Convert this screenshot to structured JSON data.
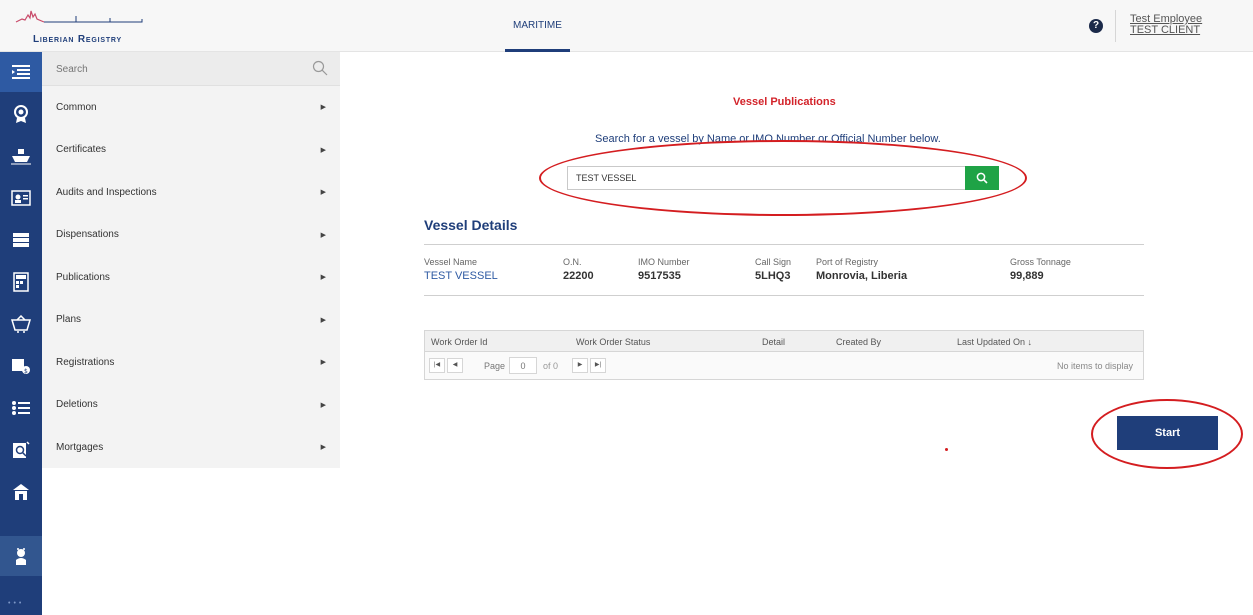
{
  "app": {
    "logo_text": "Liberian Registry",
    "accent": "#1f3e7a",
    "alert": "#d3232a",
    "success": "#1fa346"
  },
  "header": {
    "nav_tab": "MARITIME",
    "help_icon": "question-circle-icon",
    "user_name": "Test Employee",
    "user_org": "TEST CLIENT"
  },
  "rail": {
    "icons": [
      "menu-toggle-icon",
      "seal-icon",
      "ship-icon",
      "id-card-icon",
      "documents-icon",
      "calculator-icon",
      "basket-icon",
      "fees-icon",
      "list-icon",
      "inspection-icon",
      "building-icon",
      "person-icon"
    ]
  },
  "menu": {
    "search_placeholder": "Search",
    "items": [
      {
        "label": "Common"
      },
      {
        "label": "Certificates"
      },
      {
        "label": "Audits and Inspections"
      },
      {
        "label": "Dispensations"
      },
      {
        "label": "Publications"
      },
      {
        "label": "Plans"
      },
      {
        "label": "Registrations"
      },
      {
        "label": "Deletions"
      },
      {
        "label": "Mortgages"
      }
    ]
  },
  "main": {
    "title": "Vessel Publications",
    "hint": "Search for a vessel by Name or IMO Number or Official Number below.",
    "search_value": "TEST VESSEL",
    "details_title": "Vessel Details",
    "details": {
      "vessel_name_label": "Vessel Name",
      "vessel_name": "TEST VESSEL",
      "on_label": "O.N.",
      "on": "22200",
      "imo_label": "IMO Number",
      "imo": "9517535",
      "call_sign_label": "Call Sign",
      "call_sign": "5LHQ3",
      "port_label": "Port of Registry",
      "port": "Monrovia, Liberia",
      "gross_label": "Gross Tonnage",
      "gross": "99,889"
    },
    "grid": {
      "columns": [
        "Work Order Id",
        "Work Order Status",
        "Detail",
        "Created By",
        "Last Updated On ↓"
      ],
      "page_label": "Page",
      "page_value": "0",
      "of_label": "of 0",
      "empty_text": "No items to display"
    },
    "start_label": "Start"
  }
}
